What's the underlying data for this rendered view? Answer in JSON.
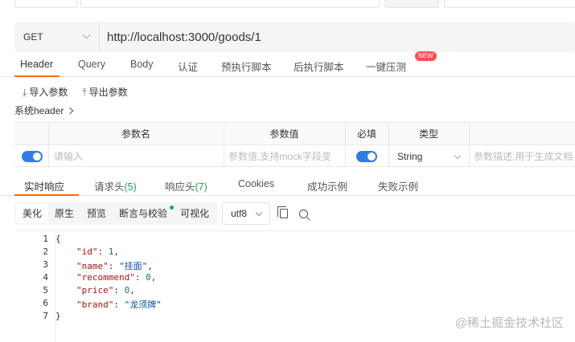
{
  "url_bar": {
    "method": "GET",
    "url": "http://localhost:3000/goods/1"
  },
  "request_tabs": [
    {
      "label": "Header",
      "active": true
    },
    {
      "label": "Query"
    },
    {
      "label": "Body"
    },
    {
      "label": "认证"
    },
    {
      "label": "预执行脚本"
    },
    {
      "label": "后执行脚本"
    },
    {
      "label": "一键压测"
    }
  ],
  "new_badge": "NEW",
  "params_actions": {
    "import": "导入参数",
    "export": "导出参数"
  },
  "system_header": "系统header",
  "params_table": {
    "headers": [
      "参数名",
      "参数值",
      "必填",
      "类型"
    ],
    "row": {
      "name_placeholder": "请输入",
      "value_placeholder": "参数值,支持mock字段变",
      "type": "String",
      "desc_placeholder": "参数描述,用于生成文档"
    }
  },
  "response_tabs": [
    {
      "label": "实时响应",
      "active": true
    },
    {
      "label": "请求头",
      "count": "(5)"
    },
    {
      "label": "响应头",
      "count": "(7)"
    },
    {
      "label": "Cookies"
    },
    {
      "label": "成功示例"
    },
    {
      "label": "失败示例"
    }
  ],
  "format_buttons": [
    {
      "label": "美化",
      "active": true
    },
    {
      "label": "原生"
    },
    {
      "label": "预览"
    },
    {
      "label": "断言与校验"
    },
    {
      "label": "可视化"
    }
  ],
  "encoding": "utf8",
  "icons": {
    "copy": "copy-icon",
    "search": "search-icon",
    "import": "import-icon",
    "export": "export-icon"
  },
  "colors": {
    "accent": "#ff6a00",
    "toggle": "#2f7ce6",
    "count": "#1aaa55"
  },
  "code_lines": [
    {
      "n": "1",
      "text": "{"
    },
    {
      "n": "2",
      "key": "\"id\"",
      "sep": ": ",
      "val": "1",
      "valType": "num",
      "end": ","
    },
    {
      "n": "3",
      "key": "\"name\"",
      "sep": ": ",
      "val": "\"挂面\"",
      "valType": "str",
      "end": ","
    },
    {
      "n": "4",
      "key": "\"recommend\"",
      "sep": ": ",
      "val": "0",
      "valType": "num",
      "end": ","
    },
    {
      "n": "5",
      "key": "\"price\"",
      "sep": ": ",
      "val": "0",
      "valType": "num",
      "end": ","
    },
    {
      "n": "6",
      "key": "\"brand\"",
      "sep": ": ",
      "val": "\"龙须牌\"",
      "valType": "str",
      "end": ""
    },
    {
      "n": "7",
      "text": "}"
    }
  ],
  "watermark": "@稀土掘金技术社区"
}
